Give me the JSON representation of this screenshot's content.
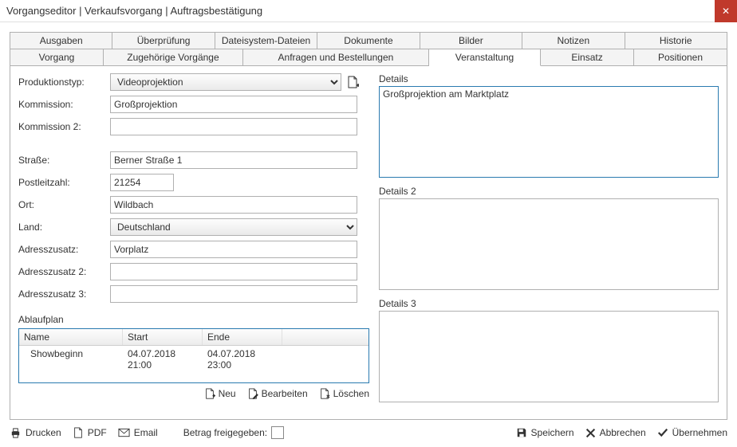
{
  "window": {
    "title": "Vorgangseditor | Verkaufsvorgang | Auftragsbestätigung"
  },
  "tabs_row1": {
    "ausgaben": "Ausgaben",
    "ueberpruefung": "Überprüfung",
    "dateisystem": "Dateisystem-Dateien",
    "dokumente": "Dokumente",
    "bilder": "Bilder",
    "notizen": "Notizen",
    "historie": "Historie"
  },
  "tabs_row2": {
    "vorgang": "Vorgang",
    "zugehoerige": "Zugehörige Vorgänge",
    "anfragen": "Anfragen und Bestellungen",
    "veranstaltung": "Veranstaltung",
    "einsatz": "Einsatz",
    "positionen": "Positionen"
  },
  "form": {
    "produktionstyp_label": "Produktionstyp:",
    "produktionstyp_value": "Videoprojektion",
    "kommission_label": "Kommission:",
    "kommission_value": "Großprojektion",
    "kommission2_label": "Kommission 2:",
    "kommission2_value": "",
    "strasse_label": "Straße:",
    "strasse_value": "Berner Straße 1",
    "plz_label": "Postleitzahl:",
    "plz_value": "21254",
    "ort_label": "Ort:",
    "ort_value": "Wildbach",
    "land_label": "Land:",
    "land_value": "Deutschland",
    "zusatz_label": "Adresszusatz:",
    "zusatz_value": "Vorplatz",
    "zusatz2_label": "Adresszusatz 2:",
    "zusatz2_value": "",
    "zusatz3_label": "Adresszusatz 3:",
    "zusatz3_value": ""
  },
  "details": {
    "label1": "Details",
    "value1": "Großprojektion am Marktplatz",
    "label2": "Details 2",
    "value2": "",
    "label3": "Details 3",
    "value3": ""
  },
  "ablauf": {
    "title": "Ablaufplan",
    "headers": {
      "name": "Name",
      "start": "Start",
      "ende": "Ende"
    },
    "rows": [
      {
        "name": "Showbeginn",
        "start": "04.07.2018 21:00",
        "ende": "04.07.2018 23:00"
      }
    ],
    "actions": {
      "neu": "Neu",
      "bearbeiten": "Bearbeiten",
      "loeschen": "Löschen"
    }
  },
  "footer": {
    "drucken": "Drucken",
    "pdf": "PDF",
    "email": "Email",
    "betrag": "Betrag freigegeben:",
    "speichern": "Speichern",
    "abbrechen": "Abbrechen",
    "uebernehmen": "Übernehmen"
  }
}
